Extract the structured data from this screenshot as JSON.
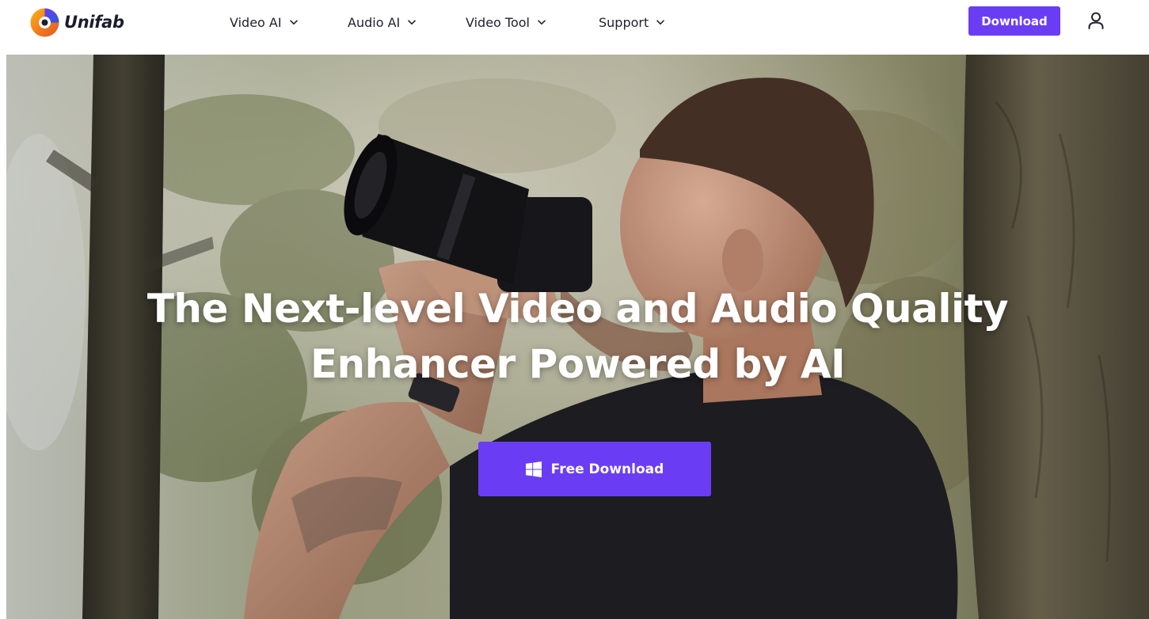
{
  "header": {
    "logo_text": "Unifab",
    "nav": [
      {
        "label": "Video AI"
      },
      {
        "label": "Audio AI"
      },
      {
        "label": "Video Tool"
      },
      {
        "label": "Support"
      }
    ],
    "download_label": "Download"
  },
  "hero": {
    "title_line1": "The Next-level Video and Audio Quality",
    "title_line2": "Enhancer Powered by AI",
    "cta_label": "Free Download"
  },
  "colors": {
    "accent": "#6a3df5",
    "text": "#222230",
    "logo_orange": "#f07a1c",
    "logo_blue": "#2a5bd7"
  },
  "icons": {
    "logo": "unifab-logo-icon",
    "nav_chevron": "chevron-down-icon",
    "user": "user-icon",
    "cta": "windows-icon"
  }
}
